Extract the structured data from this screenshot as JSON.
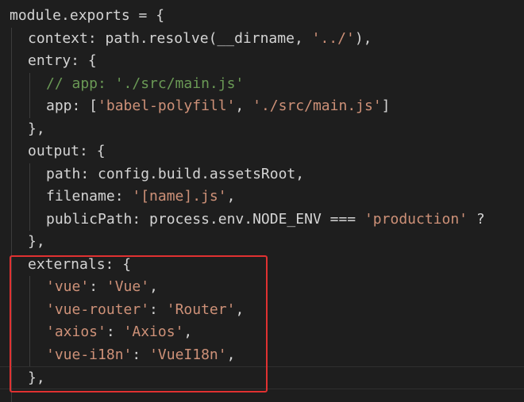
{
  "editor": {
    "lines": [
      {
        "indent": 0,
        "tokens": [
          {
            "t": "module.exports = {",
            "c": "plain"
          }
        ]
      },
      {
        "indent": 1,
        "tokens": [
          {
            "t": "context: path.resolve(__dirname, ",
            "c": "plain"
          },
          {
            "t": "'../'",
            "c": "str"
          },
          {
            "t": "),",
            "c": "plain"
          }
        ]
      },
      {
        "indent": 1,
        "tokens": [
          {
            "t": "entry: {",
            "c": "plain"
          }
        ]
      },
      {
        "indent": 2,
        "tokens": [
          {
            "t": "// app: './src/main.js'",
            "c": "comment"
          }
        ]
      },
      {
        "indent": 2,
        "tokens": [
          {
            "t": "app: [",
            "c": "plain"
          },
          {
            "t": "'babel-polyfill'",
            "c": "str"
          },
          {
            "t": ", ",
            "c": "plain"
          },
          {
            "t": "'./src/main.js'",
            "c": "str"
          },
          {
            "t": "]",
            "c": "plain"
          }
        ]
      },
      {
        "indent": 1,
        "tokens": [
          {
            "t": "},",
            "c": "plain"
          }
        ]
      },
      {
        "indent": 1,
        "tokens": [
          {
            "t": "output: {",
            "c": "plain"
          }
        ]
      },
      {
        "indent": 2,
        "tokens": [
          {
            "t": "path: config.build.assetsRoot,",
            "c": "plain"
          }
        ]
      },
      {
        "indent": 2,
        "tokens": [
          {
            "t": "filename: ",
            "c": "plain"
          },
          {
            "t": "'[name].js'",
            "c": "str"
          },
          {
            "t": ",",
            "c": "plain"
          }
        ]
      },
      {
        "indent": 2,
        "tokens": [
          {
            "t": "publicPath: process.env.NODE_ENV === ",
            "c": "plain"
          },
          {
            "t": "'production'",
            "c": "str"
          },
          {
            "t": " ?",
            "c": "plain"
          }
        ]
      },
      {
        "indent": 1,
        "tokens": [
          {
            "t": "},",
            "c": "plain"
          }
        ]
      },
      {
        "indent": 1,
        "tokens": [
          {
            "t": "externals: {",
            "c": "plain"
          }
        ]
      },
      {
        "indent": 2,
        "tokens": [
          {
            "t": "'vue'",
            "c": "str"
          },
          {
            "t": ": ",
            "c": "plain"
          },
          {
            "t": "'Vue'",
            "c": "str"
          },
          {
            "t": ",",
            "c": "plain"
          }
        ]
      },
      {
        "indent": 2,
        "tokens": [
          {
            "t": "'vue-router'",
            "c": "str"
          },
          {
            "t": ": ",
            "c": "plain"
          },
          {
            "t": "'Router'",
            "c": "str"
          },
          {
            "t": ",",
            "c": "plain"
          }
        ]
      },
      {
        "indent": 2,
        "tokens": [
          {
            "t": "'axios'",
            "c": "str"
          },
          {
            "t": ": ",
            "c": "plain"
          },
          {
            "t": "'Axios'",
            "c": "str"
          },
          {
            "t": ",",
            "c": "plain"
          }
        ]
      },
      {
        "indent": 2,
        "tokens": [
          {
            "t": "'vue-i18n'",
            "c": "str"
          },
          {
            "t": ": ",
            "c": "plain"
          },
          {
            "t": "'VueI18n'",
            "c": "str"
          },
          {
            "t": ",",
            "c": "plain"
          }
        ]
      },
      {
        "indent": 1,
        "tokens": [
          {
            "t": "},",
            "c": "plain"
          }
        ]
      },
      {
        "indent": 1,
        "tokens": [
          {
            "t": "...",
            "c": "plain"
          }
        ]
      }
    ],
    "colors": {
      "background": "#1e1e1e",
      "text": "#d4d4d4",
      "string": "#ce9178",
      "comment": "#6a9955",
      "highlight_border": "#e03131"
    }
  }
}
